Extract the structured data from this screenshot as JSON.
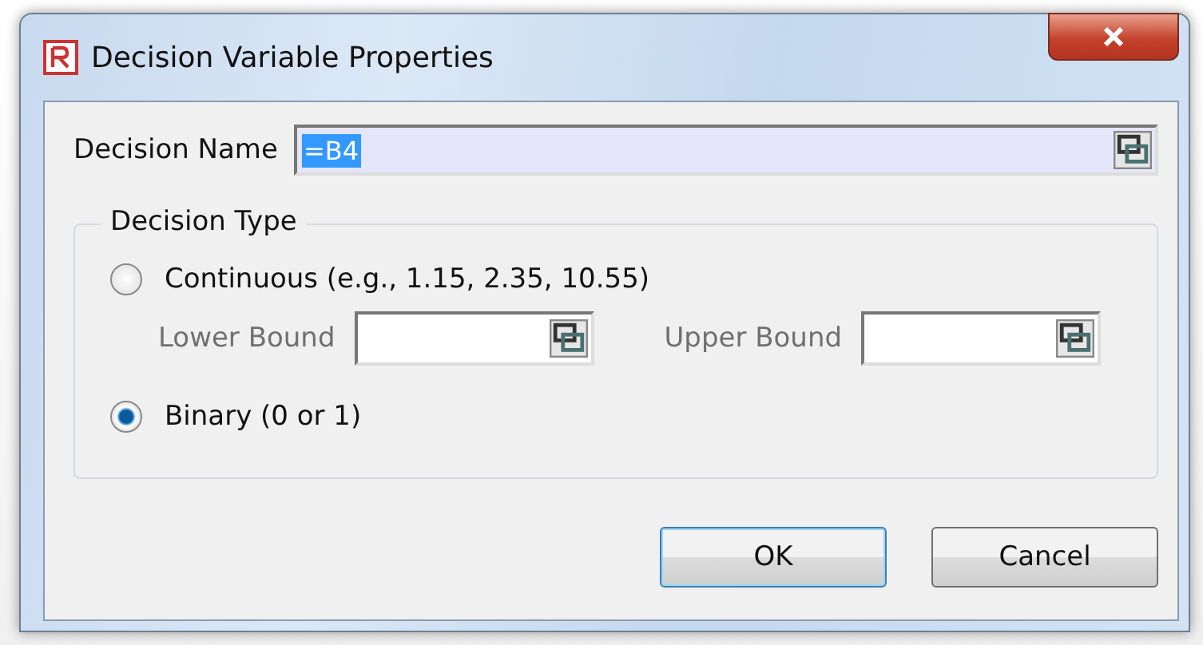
{
  "window": {
    "title": "Decision Variable Properties"
  },
  "decision_name": {
    "label": "Decision Name",
    "value": "=B4",
    "selected": true
  },
  "decision_type": {
    "title": "Decision Type",
    "options": [
      {
        "label": "Continuous (e.g., 1.15, 2.35, 10.55)",
        "selected": false
      },
      {
        "label": "Binary (0 or 1)",
        "selected": true
      }
    ],
    "bounds": [
      {
        "label": "Lower Bound",
        "disabled": true
      },
      {
        "label": "Upper Bound",
        "disabled": true
      }
    ]
  },
  "buttons": [
    {
      "label": "OK",
      "default": true
    },
    {
      "label": "Cancel",
      "default": false
    }
  ]
}
